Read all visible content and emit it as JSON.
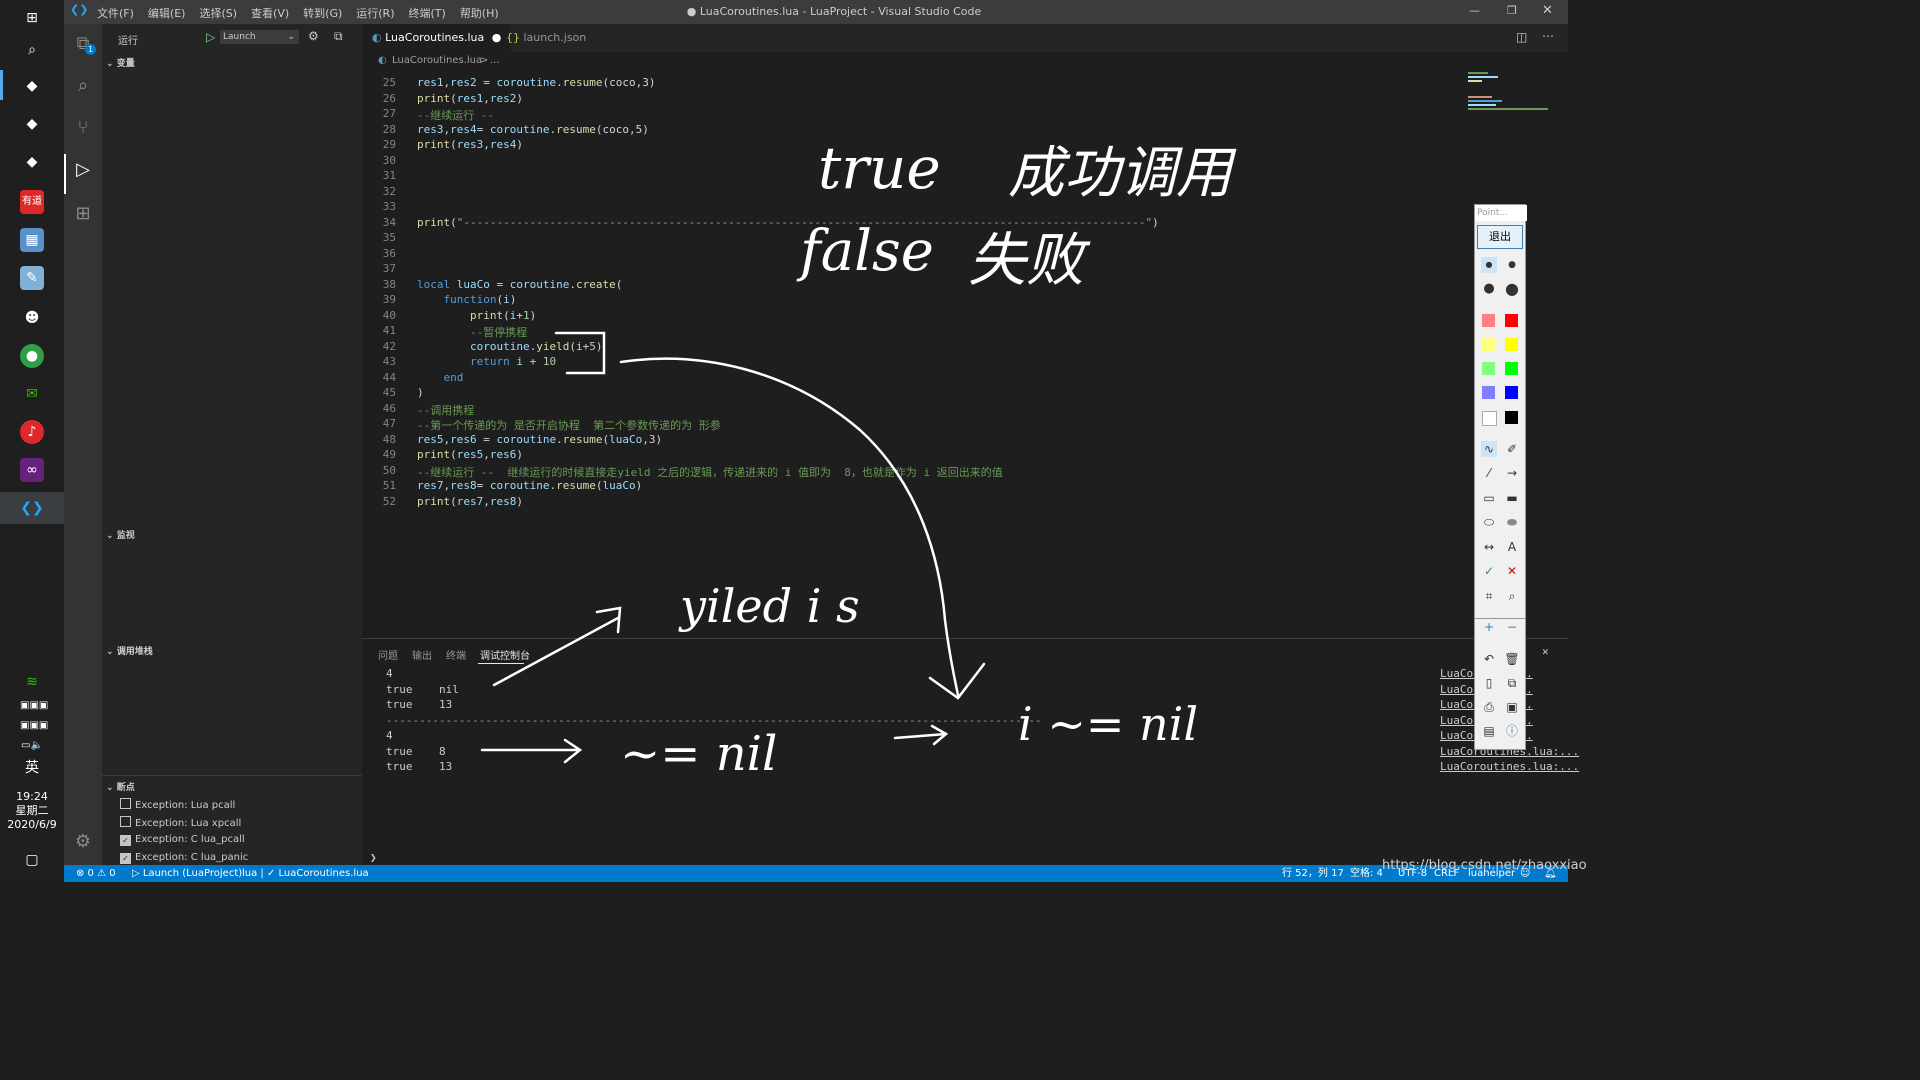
{
  "taskbar": {
    "ime": "英",
    "time": "19:24",
    "weekday": "星期二",
    "date": "2020/6/9"
  },
  "window": {
    "title": "● LuaCoroutines.lua - LuaProject - Visual Studio Code",
    "menus": [
      "文件(F)",
      "编辑(E)",
      "选择(S)",
      "查看(V)",
      "转到(G)",
      "运行(R)",
      "终端(T)",
      "帮助(H)"
    ]
  },
  "activity": {
    "badge": "1"
  },
  "sidebar": {
    "run_label": "运行",
    "config": "Launch",
    "variables": "变量",
    "watch": "监视",
    "callstack": "调用堆栈",
    "breakpoints": "断点",
    "bp_items": [
      {
        "label": "Exception: Lua pcall",
        "checked": false
      },
      {
        "label": "Exception: Lua xpcall",
        "checked": false
      },
      {
        "label": "Exception: C lua_pcall",
        "checked": true
      },
      {
        "label": "Exception: C lua_panic",
        "checked": true
      }
    ]
  },
  "tabs": [
    {
      "label": "LuaCoroutines.lua",
      "modified": "●",
      "active": true
    },
    {
      "label": "launch.json",
      "icon": "{}",
      "active": false
    }
  ],
  "breadcrumb": {
    "file": "LuaCoroutines.lua",
    "sep": ">",
    "rest": "..."
  },
  "editor": {
    "lines": [
      {
        "n": "25",
        "html": "<span class='vr'>res1</span><span class='pl'>,</span><span class='vr'>res2</span><span class='pl'> = </span><span class='vr'>coroutine</span><span class='pl'>.</span><span class='fn'>resume</span><span class='pl'>(coco,3)</span>"
      },
      {
        "n": "26",
        "html": "<span class='fn'>print</span><span class='pl'>(</span><span class='vr'>res1</span><span class='pl'>,</span><span class='vr'>res2</span><span class='pl'>)</span>"
      },
      {
        "n": "27",
        "html": "<span class='cm'>--继续运行 --</span>"
      },
      {
        "n": "28",
        "html": "<span class='vr'>res3</span><span class='pl'>,</span><span class='vr'>res4</span><span class='pl'>= </span><span class='vr'>coroutine</span><span class='pl'>.</span><span class='fn'>resume</span><span class='pl'>(coco,5)</span>"
      },
      {
        "n": "29",
        "html": "<span class='fn'>print</span><span class='pl'>(</span><span class='vr'>res3</span><span class='pl'>,</span><span class='vr'>res4</span><span class='pl'>)</span>"
      },
      {
        "n": "30",
        "html": ""
      },
      {
        "n": "31",
        "html": ""
      },
      {
        "n": "32",
        "html": ""
      },
      {
        "n": "33",
        "html": ""
      },
      {
        "n": "34",
        "html": "<span class='fn'>print</span><span class='pl'>(</span><span class='st'>\"-------------------------------------------------------------------------------------------------------\"</span><span class='pl'>)</span>"
      },
      {
        "n": "35",
        "html": ""
      },
      {
        "n": "36",
        "html": ""
      },
      {
        "n": "37",
        "html": ""
      },
      {
        "n": "38",
        "html": "<span class='kw'>local</span><span class='pl'> </span><span class='vr'>luaCo</span><span class='pl'> = </span><span class='vr'>coroutine</span><span class='pl'>.</span><span class='fn'>create</span><span class='pl'>(</span>"
      },
      {
        "n": "39",
        "html": "<span class='pl'>    </span><span class='kw'>function</span><span class='pl'>(</span><span class='vr'>i</span><span class='pl'>)</span>"
      },
      {
        "n": "40",
        "html": "<span class='pl'>        </span><span class='fn'>print</span><span class='pl'>(</span><span class='vr'>i</span><span class='pl'>+</span><span class='nm'>1</span><span class='pl'>)</span>"
      },
      {
        "n": "41",
        "html": "<span class='pl'>        </span><span class='cm'>--暂停携程</span>"
      },
      {
        "n": "42",
        "html": "<span class='pl'>        </span><span class='vr'>coroutine</span><span class='pl'>.</span><span class='fn'>yield</span><span class='pl'>(</span><span class='vr'>i</span><span class='pl'>+</span><span class='nm'>5</span><span class='pl'>)</span>"
      },
      {
        "n": "43",
        "html": "<span class='pl'>        </span><span class='kw'>return</span><span class='pl'> </span><span class='vr'>i</span><span class='pl'> + </span><span class='nm'>10</span>"
      },
      {
        "n": "44",
        "html": "<span class='pl'>    </span><span class='kw'>end</span>"
      },
      {
        "n": "45",
        "html": "<span class='pl'>)</span>"
      },
      {
        "n": "46",
        "html": "<span class='cm'>--调用携程</span>"
      },
      {
        "n": "47",
        "html": "<span class='cm'>--第一个传递的为 是否开启协程  第二个参数传递的为 形参</span>"
      },
      {
        "n": "48",
        "html": "<span class='vr'>res5</span><span class='pl'>,</span><span class='vr'>res6</span><span class='pl'> = </span><span class='vr'>coroutine</span><span class='pl'>.</span><span class='fn'>resume</span><span class='pl'>(</span><span class='vr'>luaCo</span><span class='pl'>,3)</span>"
      },
      {
        "n": "49",
        "html": "<span class='fn'>print</span><span class='pl'>(</span><span class='vr'>res5</span><span class='pl'>,</span><span class='vr'>res6</span><span class='pl'>)</span>"
      },
      {
        "n": "50",
        "html": "<span class='cm'>--继续运行 --  继续运行的时候直接走yield 之后的逻辑，传递进来的 i 值即为  8，也就是作为 i 返回出来的值</span>"
      },
      {
        "n": "51",
        "html": "<span class='vr'>res7</span><span class='pl'>,</span><span class='vr'>res8</span><span class='pl'>= </span><span class='vr'>coroutine</span><span class='pl'>.</span><span class='fn'>resume</span><span class='pl'>(</span><span class='vr'>luaCo</span><span class='pl'>)</span>"
      },
      {
        "n": "52",
        "html": "<span class='fn'>print</span><span class='pl'>(</span><span class='vr'>res7</span><span class='pl'>,</span><span class='vr'>res8</span><span class='pl'>)</span>"
      }
    ]
  },
  "panel": {
    "tabs": [
      "问题",
      "输出",
      "终端",
      "调试控制台"
    ],
    "active_tab": "调试控制台",
    "output": [
      "4",
      "true    nil",
      "true    13",
      "---------------------------------------------------------------------------------------------------",
      "4",
      "true    8",
      "true    13"
    ],
    "links": [
      "LuaCor        lua:...",
      "LuaCor        lua:...",
      "LuaCor        lua:...",
      "LuaCor        lua:...",
      "LuaCor        lua:...",
      "LuaCoroutines.lua:...",
      "LuaCoroutines.lua:..."
    ]
  },
  "statusbar": {
    "errors": "⊗ 0 ⚠ 0",
    "launch": "▷ Launch (LuaProject)",
    "lang": "lua | ✓ LuaCoroutines.lua",
    "position": "行 52，列 17",
    "spaces": "空格: 4",
    "encoding": "UTF-8",
    "eol": "CRLF",
    "helper": "luahelper"
  },
  "palette": {
    "title": "Point...",
    "exit": "退出"
  },
  "annotations": {
    "true": "true",
    "success": "成功调用",
    "false": "false",
    "fail": "失败",
    "yield": "yiled i s",
    "not_nil": "~= nil",
    "i_not_nil": "i ~= nil"
  },
  "watermark": "https://blog.csdn.net/zhaoxxiao",
  "colors": {
    "statusbar": "#007acc",
    "activity": "#333333",
    "sidebar": "#252526",
    "editor": "#1e1e1e"
  }
}
